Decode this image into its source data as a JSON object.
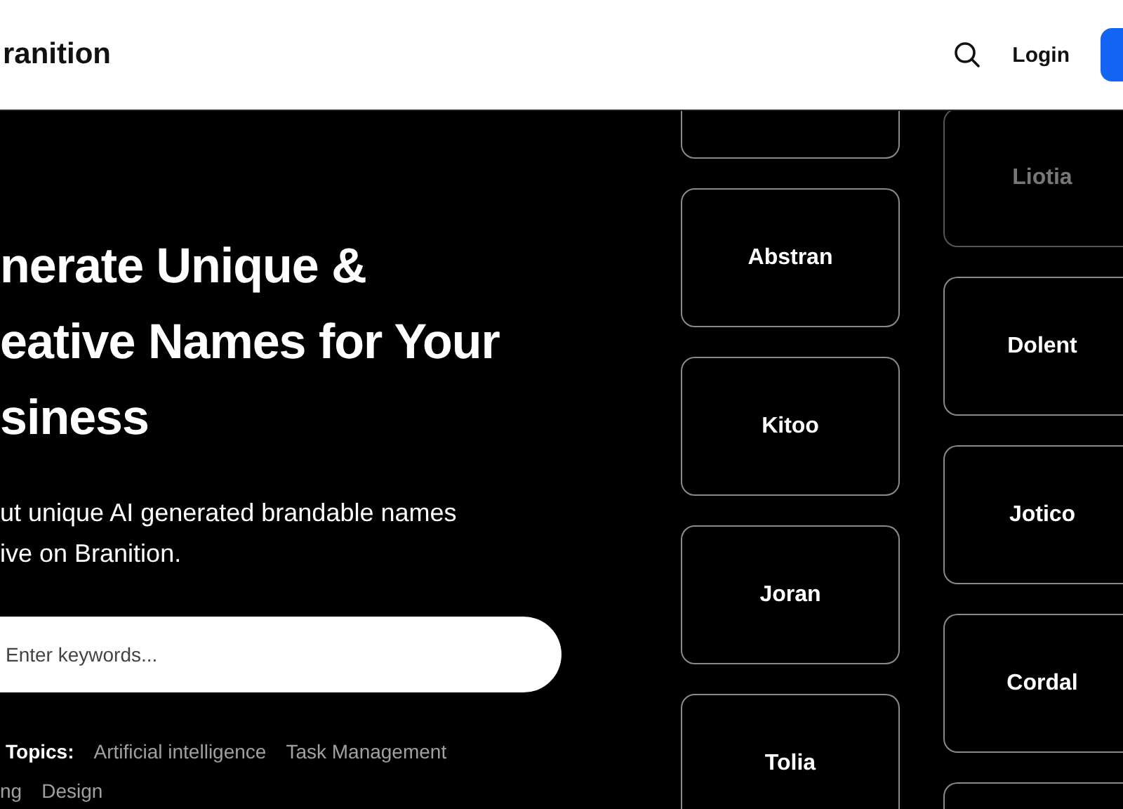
{
  "header": {
    "logo": "ranition",
    "login": "Login"
  },
  "hero": {
    "title_lines": [
      "nerate Unique &",
      "eative Names for Your",
      "siness"
    ],
    "subtitle_lines": [
      "ut unique AI generated brandable names",
      "ive on Branition."
    ],
    "search": {
      "placeholder": "Enter keywords..."
    },
    "topics": {
      "label": "Topics:",
      "rows": [
        [
          "Artificial intelligence",
          "Task Management"
        ],
        [
          "ng",
          "Design"
        ]
      ]
    }
  },
  "name_columns": [
    [
      {
        "kind": "partial"
      },
      {
        "kind": "name",
        "name": "Abstran",
        "faded": false
      },
      {
        "kind": "name",
        "name": "Kitoo",
        "faded": false
      },
      {
        "kind": "name",
        "name": "Joran",
        "faded": false
      },
      {
        "kind": "name",
        "name": "Tolia",
        "faded": false
      }
    ],
    [
      {
        "kind": "name",
        "name": "Liotia",
        "faded": true
      },
      {
        "kind": "name",
        "name": "Dolent",
        "faded": false
      },
      {
        "kind": "name",
        "name": "Jotico",
        "faded": false
      },
      {
        "kind": "name",
        "name": "Cordal",
        "faded": false
      },
      {
        "kind": "partial"
      }
    ]
  ]
}
